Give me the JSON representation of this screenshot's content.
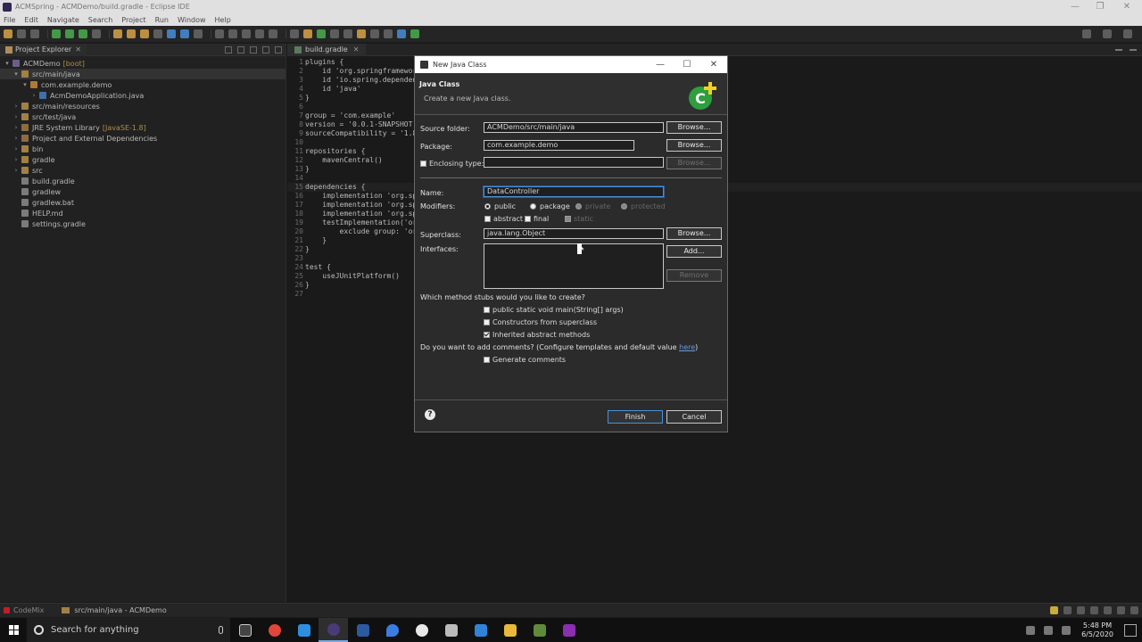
{
  "window": {
    "title": "ACMSpring - ACMDemo/build.gradle - Eclipse IDE"
  },
  "menu": [
    "File",
    "Edit",
    "Navigate",
    "Search",
    "Project",
    "Run",
    "Window",
    "Help"
  ],
  "explorer": {
    "tab_label": "Project Explorer",
    "tree": [
      {
        "indent": 0,
        "arrow": "▾",
        "icon": "proj",
        "label": "ACMDemo",
        "deco": "[boot]"
      },
      {
        "indent": 1,
        "arrow": "▾",
        "icon": "folder",
        "label": "src/main/java",
        "deco": "",
        "selected": true
      },
      {
        "indent": 2,
        "arrow": "▾",
        "icon": "pkg",
        "label": "com.example.demo",
        "deco": ""
      },
      {
        "indent": 3,
        "arrow": "›",
        "icon": "java",
        "label": "AcmDemoApplication.java",
        "deco": ""
      },
      {
        "indent": 1,
        "arrow": "›",
        "icon": "folder",
        "label": "src/main/resources",
        "deco": ""
      },
      {
        "indent": 1,
        "arrow": "›",
        "icon": "folder",
        "label": "src/test/java",
        "deco": ""
      },
      {
        "indent": 1,
        "arrow": "›",
        "icon": "lib",
        "label": "JRE System Library",
        "deco": "[JavaSE-1.8]"
      },
      {
        "indent": 1,
        "arrow": "›",
        "icon": "lib",
        "label": "Project and External Dependencies",
        "deco": ""
      },
      {
        "indent": 1,
        "arrow": "›",
        "icon": "folder",
        "label": "bin",
        "deco": ""
      },
      {
        "indent": 1,
        "arrow": "›",
        "icon": "folder",
        "label": "gradle",
        "deco": ""
      },
      {
        "indent": 1,
        "arrow": "›",
        "icon": "folder",
        "label": "src",
        "deco": ""
      },
      {
        "indent": 1,
        "arrow": "",
        "icon": "file",
        "label": "build.gradle",
        "deco": ""
      },
      {
        "indent": 1,
        "arrow": "",
        "icon": "file",
        "label": "gradlew",
        "deco": ""
      },
      {
        "indent": 1,
        "arrow": "",
        "icon": "file",
        "label": "gradlew.bat",
        "deco": ""
      },
      {
        "indent": 1,
        "arrow": "",
        "icon": "file",
        "label": "HELP.md",
        "deco": ""
      },
      {
        "indent": 1,
        "arrow": "",
        "icon": "file",
        "label": "settings.gradle",
        "deco": ""
      }
    ]
  },
  "editor": {
    "tab_label": "build.gradle",
    "lines": [
      {
        "n": "1",
        "text": "plugins {"
      },
      {
        "n": "2",
        "text": "    id 'org.springframework"
      },
      {
        "n": "3",
        "text": "    id 'io.spring.dependen"
      },
      {
        "n": "4",
        "text": "    id 'java'"
      },
      {
        "n": "5",
        "text": "}"
      },
      {
        "n": "6",
        "text": ""
      },
      {
        "n": "7",
        "text": "group = 'com.example'"
      },
      {
        "n": "8",
        "text": "version = '0.0.1-SNAPSHOT'"
      },
      {
        "n": "9",
        "text": "sourceCompatibility = '1.8"
      },
      {
        "n": "10",
        "text": ""
      },
      {
        "n": "11",
        "text": "repositories {"
      },
      {
        "n": "12",
        "text": "    mavenCentral()"
      },
      {
        "n": "13",
        "text": "}"
      },
      {
        "n": "14",
        "text": ""
      },
      {
        "n": "15",
        "text": "dependencies {",
        "hl": true
      },
      {
        "n": "16",
        "text": "    implementation 'org.sp"
      },
      {
        "n": "17",
        "text": "    implementation 'org.sp"
      },
      {
        "n": "18",
        "text": "    implementation 'org.sp"
      },
      {
        "n": "19",
        "text": "    testImplementation('or"
      },
      {
        "n": "20",
        "text": "        exclude group: 'or"
      },
      {
        "n": "21",
        "text": "    }"
      },
      {
        "n": "22",
        "text": "}"
      },
      {
        "n": "23",
        "text": ""
      },
      {
        "n": "24",
        "text": "test {"
      },
      {
        "n": "25",
        "text": "    useJUnitPlatform()"
      },
      {
        "n": "26",
        "text": "}"
      },
      {
        "n": "27",
        "text": ""
      }
    ]
  },
  "status": {
    "codemix": "CodeMix",
    "path": "src/main/java - ACMDemo"
  },
  "taskbar": {
    "search_placeholder": "Search for anything",
    "time": "5:48 PM",
    "date": "6/5/2020"
  },
  "dialog": {
    "title": "New Java Class",
    "header_title": "Java Class",
    "header_desc": "Create a new Java class.",
    "source_folder_label": "Source folder:",
    "source_folder_value": "ACMDemo/src/main/java",
    "package_label": "Package:",
    "package_value": "com.example.demo",
    "enclosing_label": "Enclosing type:",
    "enclosing_value": "",
    "name_label": "Name:",
    "name_value": "DataController",
    "modifiers_label": "Modifiers:",
    "mod_public": "public",
    "mod_package": "package",
    "mod_private": "private",
    "mod_protected": "protected",
    "mod_abstract": "abstract",
    "mod_final": "final",
    "mod_static": "static",
    "superclass_label": "Superclass:",
    "superclass_value": "java.lang.Object",
    "interfaces_label": "Interfaces:",
    "browse": "Browse...",
    "add": "Add...",
    "remove": "Remove",
    "stubs_question": "Which method stubs would you like to create?",
    "stub_main": "public static void main(String[] args)",
    "stub_constructors": "Constructors from superclass",
    "stub_inherited": "Inherited abstract methods",
    "comments_question": "Do you want to add comments? (Configure templates and default value ",
    "comments_link": "here",
    "comments_close": ")",
    "generate_comments": "Generate comments",
    "finish": "Finish",
    "cancel": "Cancel",
    "help": "?"
  }
}
